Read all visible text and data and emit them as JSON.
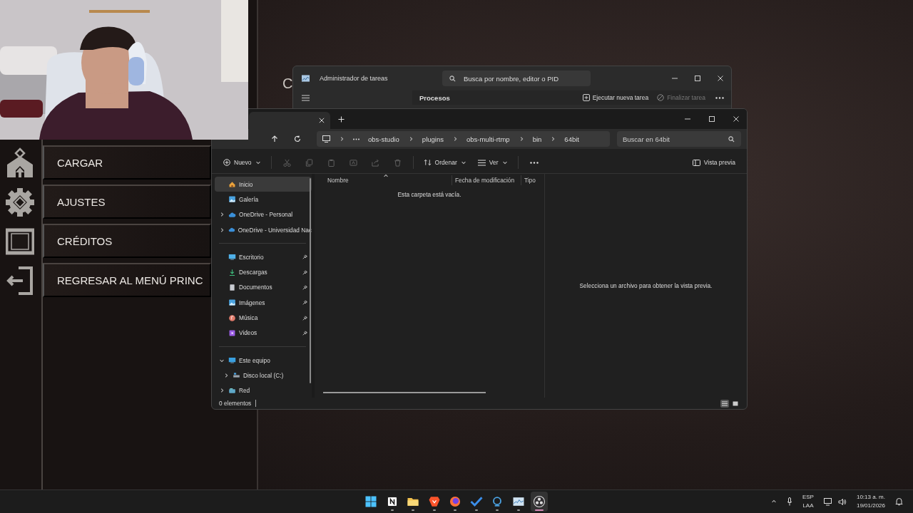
{
  "game_menu": {
    "partial_title": "C",
    "items": [
      {
        "label": "CARGAR",
        "kind": "load"
      },
      {
        "label": "AJUSTES",
        "kind": "settings"
      },
      {
        "label": "CRÉDITOS",
        "kind": "film"
      },
      {
        "label": "REGRESAR AL MENÚ PRINC",
        "kind": "exit"
      }
    ]
  },
  "task_manager": {
    "title": "Administrador de tareas",
    "search": {
      "placeholder": "Busca por nombre, editor o PID"
    },
    "section": "Procesos",
    "actions": [
      {
        "label": "Ejecutar nueva tarea",
        "kind": "run",
        "disabled": false
      },
      {
        "label": "Finalizar tarea",
        "kind": "end",
        "disabled": true
      }
    ]
  },
  "explorer": {
    "breadcrumb": [
      "obs-studio",
      "plugins",
      "obs-multi-rtmp",
      "bin",
      "64bit"
    ],
    "search": {
      "placeholder": "Buscar en 64bit"
    },
    "toolbar": {
      "new": "Nuevo",
      "sort": "Ordenar",
      "view": "Ver",
      "preview": "Vista previa"
    },
    "nav_groups": [
      [
        {
          "label": "Inicio",
          "kind": "home",
          "selected": true
        },
        {
          "label": "Galería",
          "kind": "gallery",
          "selected": false
        },
        {
          "label": "OneDrive - Personal",
          "kind": "cloud",
          "selected": false,
          "expanded": false
        },
        {
          "label": "OneDrive - Universidad Nac",
          "kind": "cloud",
          "selected": false,
          "expanded": false
        }
      ],
      [
        {
          "label": "Escritorio",
          "kind": "desktop",
          "selected": false,
          "pinned": true
        },
        {
          "label": "Descargas",
          "kind": "download",
          "selected": false,
          "pinned": true
        },
        {
          "label": "Documentos",
          "kind": "document",
          "selected": false,
          "pinned": true
        },
        {
          "label": "Imágenes",
          "kind": "gallery",
          "selected": false,
          "pinned": true
        },
        {
          "label": "Música",
          "kind": "music",
          "selected": false,
          "pinned": true
        },
        {
          "label": "Videos",
          "kind": "video",
          "selected": false,
          "pinned": true
        }
      ],
      [
        {
          "label": "Este equipo",
          "kind": "pc",
          "selected": false,
          "expanded": true,
          "children": [
            {
              "label": "Disco local (C:)",
              "kind": "drive",
              "selected": false,
              "expanded": false
            }
          ]
        },
        {
          "label": "Red",
          "kind": "network",
          "selected": false,
          "expanded": false
        }
      ]
    ],
    "columns": [
      "Nombre",
      "Fecha de modificación",
      "Tipo"
    ],
    "empty_message": "Esta carpeta está vacía.",
    "preview_hint": "Selecciona un archivo para obtener la vista previa.",
    "status": "0 elementos",
    "view_modes": [
      {
        "kind": "details",
        "selected": true
      },
      {
        "kind": "tiles",
        "selected": false
      }
    ]
  },
  "taskbar": {
    "apps": [
      {
        "kind": "start",
        "selected": false
      },
      {
        "kind": "notion",
        "selected": false
      },
      {
        "kind": "folder",
        "selected": false
      },
      {
        "kind": "brave",
        "selected": false
      },
      {
        "kind": "firefox",
        "selected": false
      },
      {
        "kind": "todo",
        "selected": false
      },
      {
        "kind": "ring",
        "selected": false
      },
      {
        "kind": "monitor",
        "selected": false
      },
      {
        "kind": "obs",
        "selected": true
      }
    ],
    "language": "ESP",
    "layout": "LAA",
    "time": "10:13 a. m.",
    "date": "19/01/2026"
  }
}
